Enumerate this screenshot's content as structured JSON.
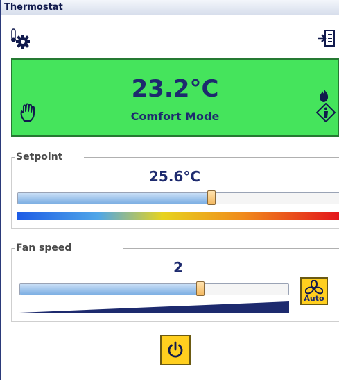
{
  "window": {
    "title": "Thermostat"
  },
  "toolbar": {
    "settings_icon": "thermometer-gear-icon",
    "menu_icon": "list-arrow-icon"
  },
  "status": {
    "temperature": "23.2°C",
    "mode": "Comfort Mode",
    "background_color": "#45e45c",
    "icons": [
      "flame-icon",
      "hand-icon",
      "info-diamond-icon"
    ]
  },
  "setpoint": {
    "title": "Setpoint",
    "value": "25.6°C",
    "slider_fraction": 0.6
  },
  "fan": {
    "title": "Fan speed",
    "value": "2",
    "slider_fraction": 0.67,
    "auto_label": "Auto"
  },
  "power": {
    "icon": "power-icon"
  }
}
